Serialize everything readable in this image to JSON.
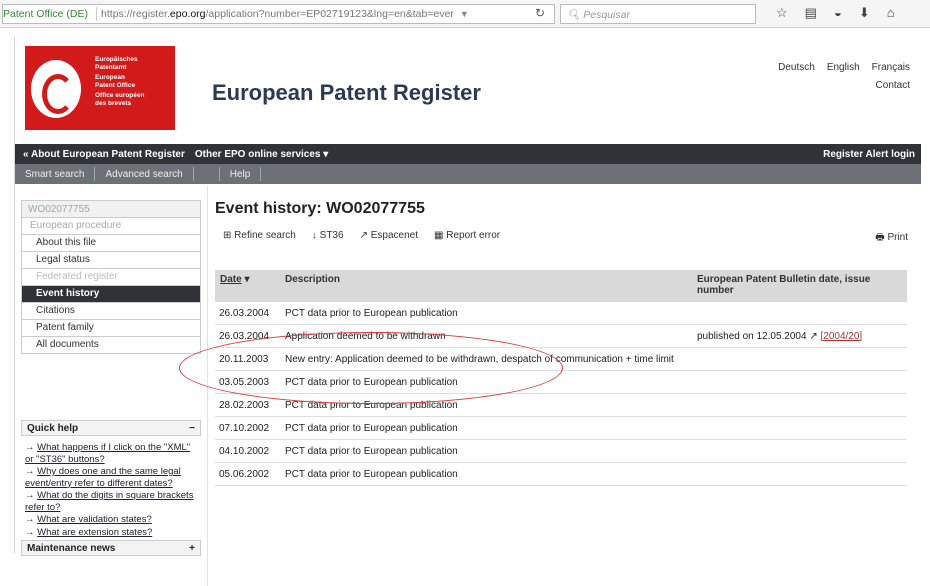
{
  "browser": {
    "site_identity": "Patent Office (DE)",
    "url_prefix": "https://register.",
    "url_domain": "epo.org",
    "url_rest": "/application?number=EP02719123&lng=en&tab=ever",
    "search_placeholder": "Pesquisar"
  },
  "header": {
    "logo_lines": [
      "Europäisches",
      "Patentamt",
      "European",
      "Patent Office",
      "Office européen",
      "des brevets"
    ],
    "title": "European Patent Register",
    "languages": [
      "Deutsch",
      "English",
      "Français"
    ],
    "contact": "Contact"
  },
  "navbar": {
    "about": "« About European Patent Register",
    "other": "Other EPO online services ▾",
    "alert": "Register Alert login"
  },
  "subnav": {
    "smart": "Smart search",
    "advanced": "Advanced search",
    "help": "Help"
  },
  "sidebar": {
    "head": "WO02077755",
    "items": [
      {
        "label": "European procedure"
      },
      {
        "label": "About this file"
      },
      {
        "label": "Legal status"
      },
      {
        "label": "Federated register"
      },
      {
        "label": "Event history"
      },
      {
        "label": "Citations"
      },
      {
        "label": "Patent family"
      },
      {
        "label": "All documents"
      }
    ]
  },
  "quickhelp": {
    "title": "Quick help",
    "toggle": "−",
    "links": [
      "What happens if I click on the \"XML\" or \"ST36\" buttons?",
      "Why does one and the same legal event/entry refer to different dates?",
      "What do the digits in square brackets refer to?",
      "What are validation states?",
      "What are extension states?"
    ]
  },
  "maintenance": {
    "title": "Maintenance news",
    "toggle": "+"
  },
  "main": {
    "title": "Event history: WO02077755",
    "tools": {
      "refine": "Refine search",
      "st36": "ST36",
      "espacenet": "Espacenet",
      "report": "Report error",
      "print": "Print"
    },
    "columns": {
      "date": "Date",
      "description": "Description",
      "bulletin": "European Patent Bulletin date, issue number"
    },
    "rows": [
      {
        "date": "26.03.2004",
        "desc": "PCT data prior to European publication",
        "bulletin": "",
        "link": ""
      },
      {
        "date": "26.03.2004",
        "desc": "Application deemed to be withdrawn",
        "bulletin": "published on  12.05.2004 ↗",
        "link": "[2004/20]"
      },
      {
        "date": "20.11.2003",
        "desc": "New entry: Application deemed to be withdrawn, despatch of communication + time limit",
        "bulletin": "",
        "link": ""
      },
      {
        "date": "03.05.2003",
        "desc": "PCT data prior to European publication",
        "bulletin": "",
        "link": ""
      },
      {
        "date": "28.02.2003",
        "desc": "PCT data prior to European publication",
        "bulletin": "",
        "link": ""
      },
      {
        "date": "07.10.2002",
        "desc": "PCT data prior to European publication",
        "bulletin": "",
        "link": ""
      },
      {
        "date": "04.10.2002",
        "desc": "PCT data prior to European publication",
        "bulletin": "",
        "link": ""
      },
      {
        "date": "05.06.2002",
        "desc": "PCT data prior to European publication",
        "bulletin": "",
        "link": ""
      }
    ]
  },
  "colors": {
    "brand_red": "#d31a1a",
    "nav_dark": "#2f3338",
    "annotation": "#d93b3b"
  }
}
